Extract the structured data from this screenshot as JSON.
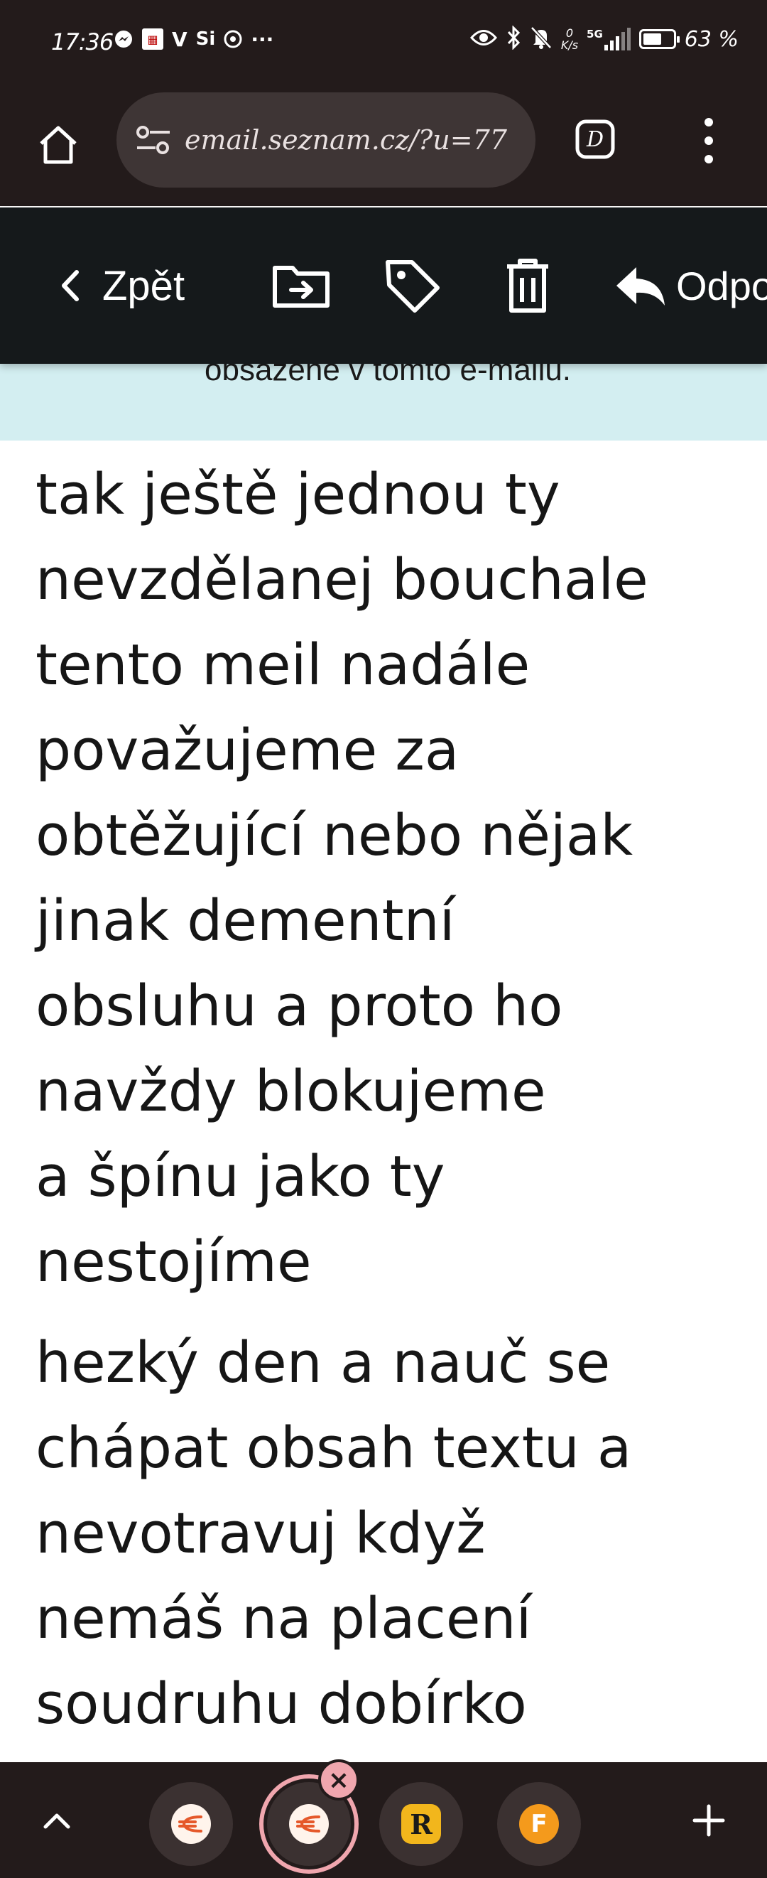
{
  "status_bar": {
    "time": "17:36",
    "left_icons": [
      "messenger-icon",
      "ruler-icon",
      "v-icon",
      "si-icon",
      "app-icon"
    ],
    "more": "···",
    "speed_value": "0",
    "speed_unit": "K/s",
    "network": "5G",
    "battery_percent": "63 %",
    "battery_level": 0.63
  },
  "browser": {
    "url": "email.seznam.cz/?u=77",
    "tab_count_symbol": "D"
  },
  "mail_toolbar": {
    "back_label": "Zpět",
    "reply_label": "Odpo"
  },
  "banner": {
    "text": "obsažené v tomto e-mailu."
  },
  "message": {
    "paragraph1": [
      "tak ještě jednou ty",
      "nevzdělanej bouchale",
      "tento meil nadále",
      "považujeme za",
      "obtěžující nebo nějak",
      "jinak dementní",
      "obsluhu a proto ho",
      "navždy blokujeme",
      "a špínu jako ty",
      "nestojíme"
    ],
    "paragraph2": [
      "hezký den a nauč se",
      "chápat obsah textu a",
      "nevotravuj když",
      "nemáš na placení",
      "soudruhu dobírko"
    ]
  },
  "bottom_bar": {
    "tabs": [
      {
        "icon": "seznam-favicon",
        "letter": "€"
      },
      {
        "icon": "seznam-favicon",
        "letter": "€"
      },
      {
        "icon": "r-favicon",
        "letter": "R"
      },
      {
        "icon": "f-favicon",
        "letter": "F"
      }
    ],
    "close_symbol": "×",
    "add_symbol": "+"
  },
  "colors": {
    "system_bar": "#231b1b",
    "toolbar": "#15191b",
    "banner": "#d3eef1",
    "active_tab_ring": "#f0a6ae"
  }
}
